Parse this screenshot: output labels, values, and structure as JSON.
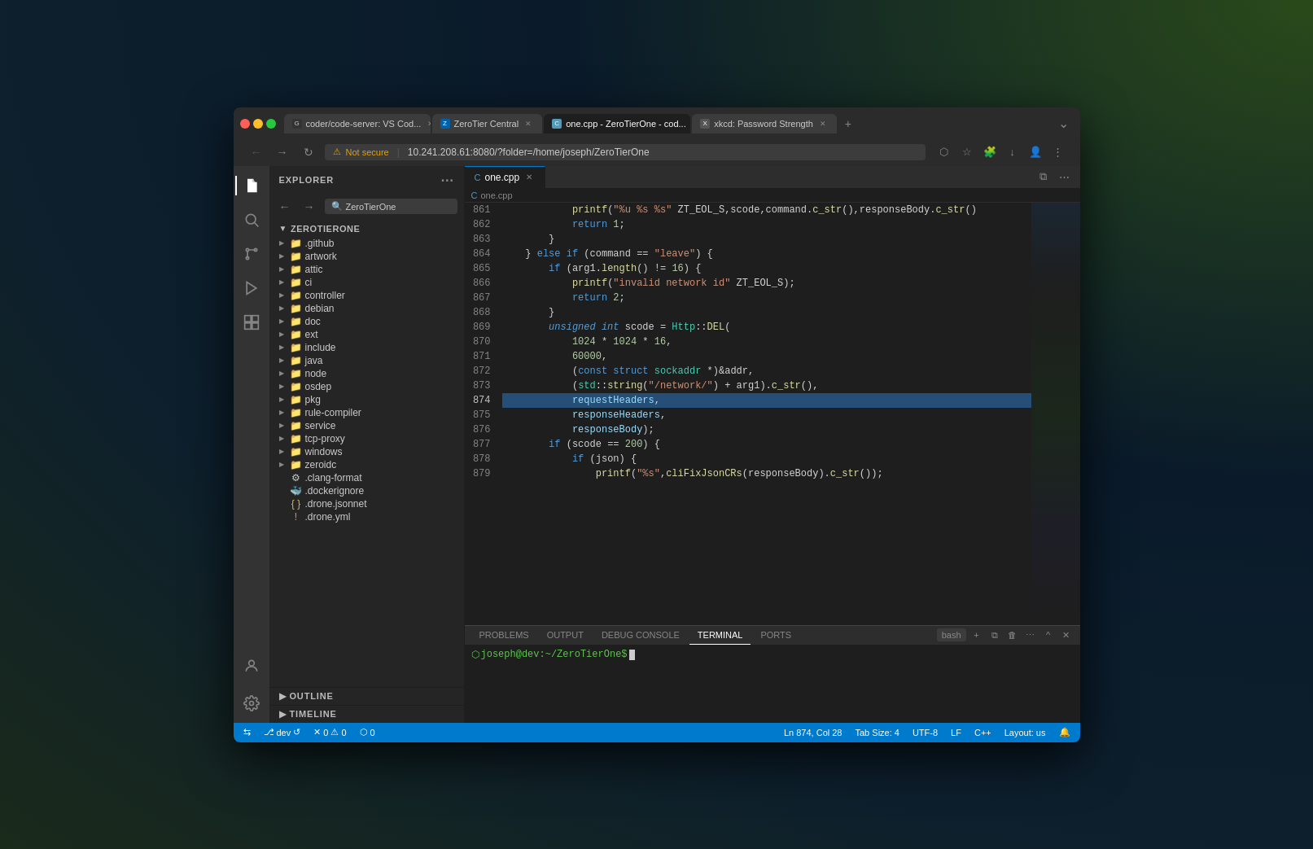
{
  "browser": {
    "tabs": [
      {
        "id": "tab1",
        "favicon": "gh",
        "label": "coder/code-server: VS Cod...",
        "active": false
      },
      {
        "id": "tab2",
        "favicon": "zt",
        "label": "ZeroTier Central",
        "active": false
      },
      {
        "id": "tab3",
        "favicon": "cpp",
        "label": "one.cpp - ZeroTierOne - cod...",
        "active": true
      },
      {
        "id": "tab4",
        "favicon": "xk",
        "label": "xkcd: Password Strength",
        "active": false
      }
    ],
    "url": "10.241.208.61:8080/?folder=/home/joseph/ZeroTierOne",
    "url_warning": "Not secure",
    "search_placeholder": "ZeroTierOne"
  },
  "sidebar": {
    "title": "EXPLORER",
    "root_folder": "ZEROTIERONE",
    "items": [
      {
        "type": "folder",
        "name": ".github",
        "depth": 1
      },
      {
        "type": "folder",
        "name": "artwork",
        "depth": 1
      },
      {
        "type": "folder",
        "name": "attic",
        "depth": 1
      },
      {
        "type": "folder",
        "name": "ci",
        "depth": 1
      },
      {
        "type": "folder",
        "name": "controller",
        "depth": 1
      },
      {
        "type": "folder",
        "name": "debian",
        "depth": 1
      },
      {
        "type": "folder",
        "name": "doc",
        "depth": 1
      },
      {
        "type": "folder",
        "name": "ext",
        "depth": 1
      },
      {
        "type": "folder",
        "name": "include",
        "depth": 1
      },
      {
        "type": "folder",
        "name": "java",
        "depth": 1
      },
      {
        "type": "folder",
        "name": "node",
        "depth": 1
      },
      {
        "type": "folder",
        "name": "osdep",
        "depth": 1
      },
      {
        "type": "folder",
        "name": "pkg",
        "depth": 1
      },
      {
        "type": "folder",
        "name": "rule-compiler",
        "depth": 1
      },
      {
        "type": "folder",
        "name": "service",
        "depth": 1
      },
      {
        "type": "folder",
        "name": "tcp-proxy",
        "depth": 1
      },
      {
        "type": "folder",
        "name": "windows",
        "depth": 1
      },
      {
        "type": "folder",
        "name": "zeroidc",
        "depth": 1
      },
      {
        "type": "file",
        "name": ".clang-format",
        "depth": 1
      },
      {
        "type": "file",
        "name": ".dockerignore",
        "depth": 1
      },
      {
        "type": "file",
        "name": ".drone.jsonnet",
        "depth": 1
      },
      {
        "type": "file",
        "name": "!  .drone.yml",
        "depth": 1
      }
    ],
    "outline_label": "OUTLINE",
    "timeline_label": "TIMELINE"
  },
  "editor": {
    "active_file": "one.cpp",
    "lines": [
      {
        "num": 861,
        "content": "            printf(\"%u %s %s\" ZT_EOL_S,scode,command.c_str(),responseBody.c_str()",
        "highlighted": false
      },
      {
        "num": 862,
        "content": "            return 1;",
        "highlighted": false
      },
      {
        "num": 863,
        "content": "        }",
        "highlighted": false
      },
      {
        "num": 864,
        "content": "    } else if (command == \"leave\") {",
        "highlighted": false
      },
      {
        "num": 865,
        "content": "        if (arg1.length() != 16) {",
        "highlighted": false
      },
      {
        "num": 866,
        "content": "            printf(\"invalid network id\" ZT_EOL_S);",
        "highlighted": false
      },
      {
        "num": 867,
        "content": "            return 2;",
        "highlighted": false
      },
      {
        "num": 868,
        "content": "        }",
        "highlighted": false
      },
      {
        "num": 869,
        "content": "        unsigned int scode = Http::DEL(",
        "highlighted": false
      },
      {
        "num": 870,
        "content": "            1024 * 1024 * 16,",
        "highlighted": false
      },
      {
        "num": 871,
        "content": "            60000,",
        "highlighted": false
      },
      {
        "num": 872,
        "content": "            (const struct sockaddr *)&addr,",
        "highlighted": false
      },
      {
        "num": 873,
        "content": "            (std::string(\"/network/\") + arg1).c_str(),",
        "highlighted": false
      },
      {
        "num": 874,
        "content": "            requestHeaders,",
        "highlighted": true
      },
      {
        "num": 875,
        "content": "            responseHeaders,",
        "highlighted": false
      },
      {
        "num": 876,
        "content": "            responseBody);",
        "highlighted": false
      },
      {
        "num": 877,
        "content": "        if (scode == 200) {",
        "highlighted": false
      },
      {
        "num": 878,
        "content": "            if (json) {",
        "highlighted": false
      },
      {
        "num": 879,
        "content": "                printf(\"%s\",cliFixJsonCRs(responseBody).c_str());",
        "highlighted": false
      }
    ]
  },
  "terminal": {
    "tabs": [
      "PROBLEMS",
      "OUTPUT",
      "DEBUG CONSOLE",
      "TERMINAL",
      "PORTS"
    ],
    "active_tab": "TERMINAL",
    "shell": "bash",
    "cwd": "~/ZeroTierOne",
    "user": "joseph",
    "host": "dev",
    "prompt": "joseph@dev:~/ZeroTierOne$"
  },
  "status_bar": {
    "branch": "dev",
    "sync_icon": "↺",
    "errors": "0",
    "warnings": "0",
    "remote": "0",
    "position": "Ln 874, Col 28",
    "tab_size": "Tab Size: 4",
    "encoding": "UTF-8",
    "line_ending": "LF",
    "language": "C++",
    "layout": "Layout: us",
    "bell_icon": "🔔"
  },
  "activity_bar": {
    "icons": [
      {
        "name": "files",
        "symbol": "⎘",
        "active": true
      },
      {
        "name": "search",
        "symbol": "🔍",
        "active": false
      },
      {
        "name": "source-control",
        "symbol": "⑂",
        "active": false
      },
      {
        "name": "run-debug",
        "symbol": "▷",
        "active": false
      },
      {
        "name": "extensions",
        "symbol": "⊞",
        "active": false
      }
    ],
    "bottom_icons": [
      {
        "name": "account",
        "symbol": "👤"
      },
      {
        "name": "settings",
        "symbol": "⚙"
      }
    ]
  }
}
